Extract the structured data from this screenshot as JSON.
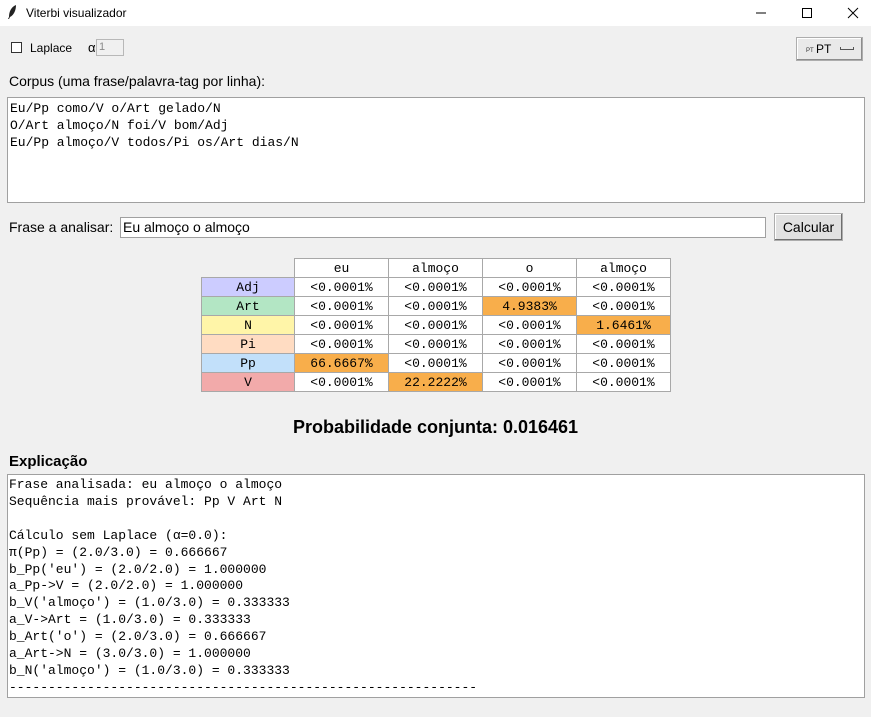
{
  "window": {
    "title": "Viterbi visualizador"
  },
  "options": {
    "laplace_label": "Laplace",
    "laplace_checked": false,
    "alpha_symbol": "α",
    "alpha_value": "1",
    "language_button": "PT",
    "language_flag": "PT"
  },
  "corpus": {
    "label": "Corpus (uma frase/palavra-tag por linha):",
    "text": "Eu/Pp como/V o/Art gelado/N\nO/Art almoço/N foi/V bom/Adj\nEu/Pp almoço/V todos/Pi os/Art dias/N"
  },
  "sentence": {
    "label": "Frase a analisar:",
    "value": "Eu almoço o almoço",
    "calc_button": "Calcular"
  },
  "table": {
    "columns": [
      "eu",
      "almoço",
      "o",
      "almoço"
    ],
    "rows": [
      {
        "tag": "Adj",
        "color": "#ccccff",
        "cells": [
          "<0.0001%",
          "<0.0001%",
          "<0.0001%",
          "<0.0001%"
        ],
        "highlight": [
          false,
          false,
          false,
          false
        ]
      },
      {
        "tag": "Art",
        "color": "#b3e6c4",
        "cells": [
          "<0.0001%",
          "<0.0001%",
          "4.9383%",
          "<0.0001%"
        ],
        "highlight": [
          false,
          false,
          true,
          false
        ]
      },
      {
        "tag": "N",
        "color": "#fff5a8",
        "cells": [
          "<0.0001%",
          "<0.0001%",
          "<0.0001%",
          "1.6461%"
        ],
        "highlight": [
          false,
          false,
          false,
          true
        ]
      },
      {
        "tag": "Pi",
        "color": "#ffdcc2",
        "cells": [
          "<0.0001%",
          "<0.0001%",
          "<0.0001%",
          "<0.0001%"
        ],
        "highlight": [
          false,
          false,
          false,
          false
        ]
      },
      {
        "tag": "Pp",
        "color": "#c2e0fa",
        "cells": [
          "66.6667%",
          "<0.0001%",
          "<0.0001%",
          "<0.0001%"
        ],
        "highlight": [
          true,
          false,
          false,
          false
        ]
      },
      {
        "tag": "V",
        "color": "#f2aaaa",
        "cells": [
          "<0.0001%",
          "22.2222%",
          "<0.0001%",
          "<0.0001%"
        ],
        "highlight": [
          false,
          true,
          false,
          false
        ]
      }
    ],
    "highlight_color": "#f8ae4b"
  },
  "probability": {
    "text": "Probabilidade conjunta: 0.016461"
  },
  "explanation": {
    "label": "Explicação",
    "text": "Frase analisada: eu almoço o almoço\nSequência mais provável: Pp V Art N\n\nCálculo sem Laplace (α=0.0):\nπ(Pp) = (2.0/3.0) = 0.666667\nb_Pp('eu') = (2.0/2.0) = 1.000000\na_Pp->V = (2.0/2.0) = 1.000000\nb_V('almoço') = (1.0/3.0) = 0.333333\na_V->Art = (1.0/3.0) = 0.333333\nb_Art('o') = (2.0/3.0) = 0.666667\na_Art->N = (3.0/3.0) = 1.000000\nb_N('almoço') = (1.0/3.0) = 0.333333\n------------------------------------------------------------"
  }
}
